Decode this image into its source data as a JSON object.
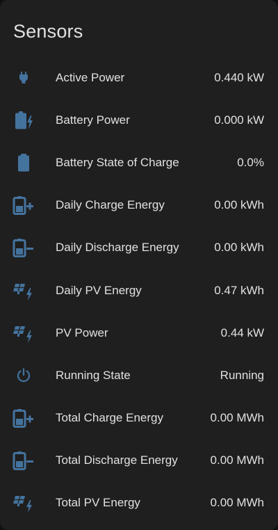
{
  "card": {
    "title": "Sensors",
    "icon_color": "#44739e"
  },
  "rows": [
    {
      "icon": "power-plug-icon",
      "label": "Active Power",
      "value": "0.440 kW"
    },
    {
      "icon": "battery-charging-icon",
      "label": "Battery Power",
      "value": "0.000 kW"
    },
    {
      "icon": "battery-icon",
      "label": "Battery State of Charge",
      "value": "0.0%"
    },
    {
      "icon": "battery-plus-icon",
      "label": "Daily Charge Energy",
      "value": "0.00 kWh"
    },
    {
      "icon": "battery-minus-icon",
      "label": "Daily Discharge Energy",
      "value": "0.00 kWh"
    },
    {
      "icon": "solar-power-icon",
      "label": "Daily PV Energy",
      "value": "0.47 kWh"
    },
    {
      "icon": "solar-power-icon",
      "label": "PV Power",
      "value": "0.44 kW"
    },
    {
      "icon": "power-icon",
      "label": "Running State",
      "value": "Running"
    },
    {
      "icon": "battery-plus-icon",
      "label": "Total Charge Energy",
      "value": "0.00 MWh"
    },
    {
      "icon": "battery-minus-icon",
      "label": "Total Discharge Energy",
      "value": "0.00 MWh"
    },
    {
      "icon": "solar-power-icon",
      "label": "Total PV Energy",
      "value": "0.00 MWh"
    }
  ]
}
